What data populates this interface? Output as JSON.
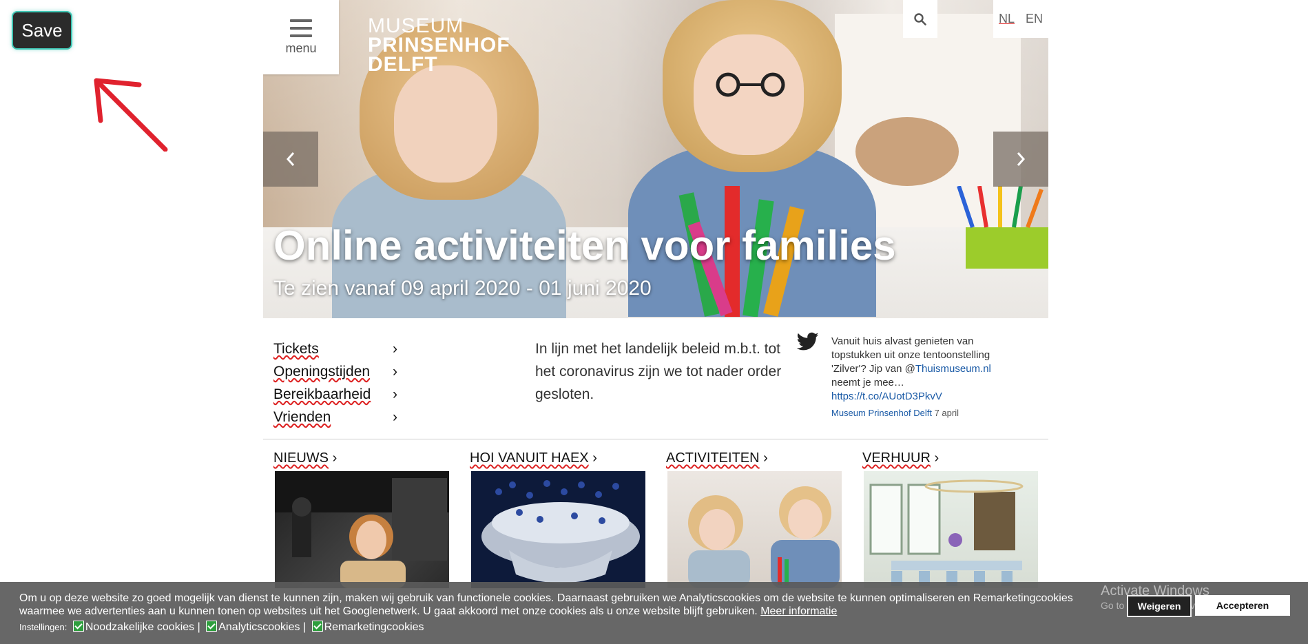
{
  "save_button": {
    "label": "Save"
  },
  "header": {
    "menu_label": "menu",
    "logo": {
      "line1": "MUSEUM",
      "line2": "PRINSENHOF",
      "line3": "DELFT"
    },
    "languages": [
      "NL",
      "EN"
    ],
    "search_icon": "search-icon"
  },
  "hero": {
    "title": "Online activiteiten voor families",
    "subtitle": "Te zien vanaf 09 april 2020 - 01 juni 2020"
  },
  "quick_links": [
    {
      "label": "Tickets"
    },
    {
      "label": "Openingstijden"
    },
    {
      "label": "Bereikbaarheid"
    },
    {
      "label": "Vrienden"
    }
  ],
  "notice": {
    "text": "In lijn met het landelijk beleid m.b.t. tot het coronavirus zijn we tot nader order gesloten."
  },
  "tweet": {
    "text": "Vanuit huis alvast genieten van topstukken uit onze tentoonstelling 'Zilver'? Jip van @",
    "mention": "Thuismuseum.nl",
    "text2": " neemt je mee…",
    "link": "https://t.co/AUotD3PkvV",
    "author": "Museum Prinsenhof Delft",
    "date": " 7 april"
  },
  "sections": [
    {
      "label": "NIEUWS"
    },
    {
      "label": "HOI VANUIT HAEX"
    },
    {
      "label": "ACTIVITEITEN"
    },
    {
      "label": "VERHUUR"
    }
  ],
  "cookie_bar": {
    "text": "Om u op deze website zo goed mogelijk van dienst te kunnen zijn, maken wij gebruik van functionele cookies. Daarnaast gebruiken we Analyticscookies om de website te kunnen optimaliseren en Remarketingcookies waarmee we advertenties aan u kunnen tonen op websites uit het Googlenetwerk. U gaat akkoord met onze cookies als u onze website blijft gebruiken. ",
    "more_info": "Meer informatie",
    "settings_label": "Instellingen:",
    "options": [
      "Noodzakelijke cookies",
      "Analyticscookies",
      "Remarketingcookies"
    ],
    "separator": "|",
    "reject_label": "Weigeren",
    "accept_label": "Accepteren"
  },
  "windows_watermark": {
    "line1": "Activate Windows",
    "line2": "Go to Settings to activate Windows."
  },
  "colors": {
    "accent_teal": "#3fc7b5",
    "annotation_red": "#e0222e",
    "link_blue": "#1a5aa6",
    "cookie_bg": "#5a5a5a"
  }
}
